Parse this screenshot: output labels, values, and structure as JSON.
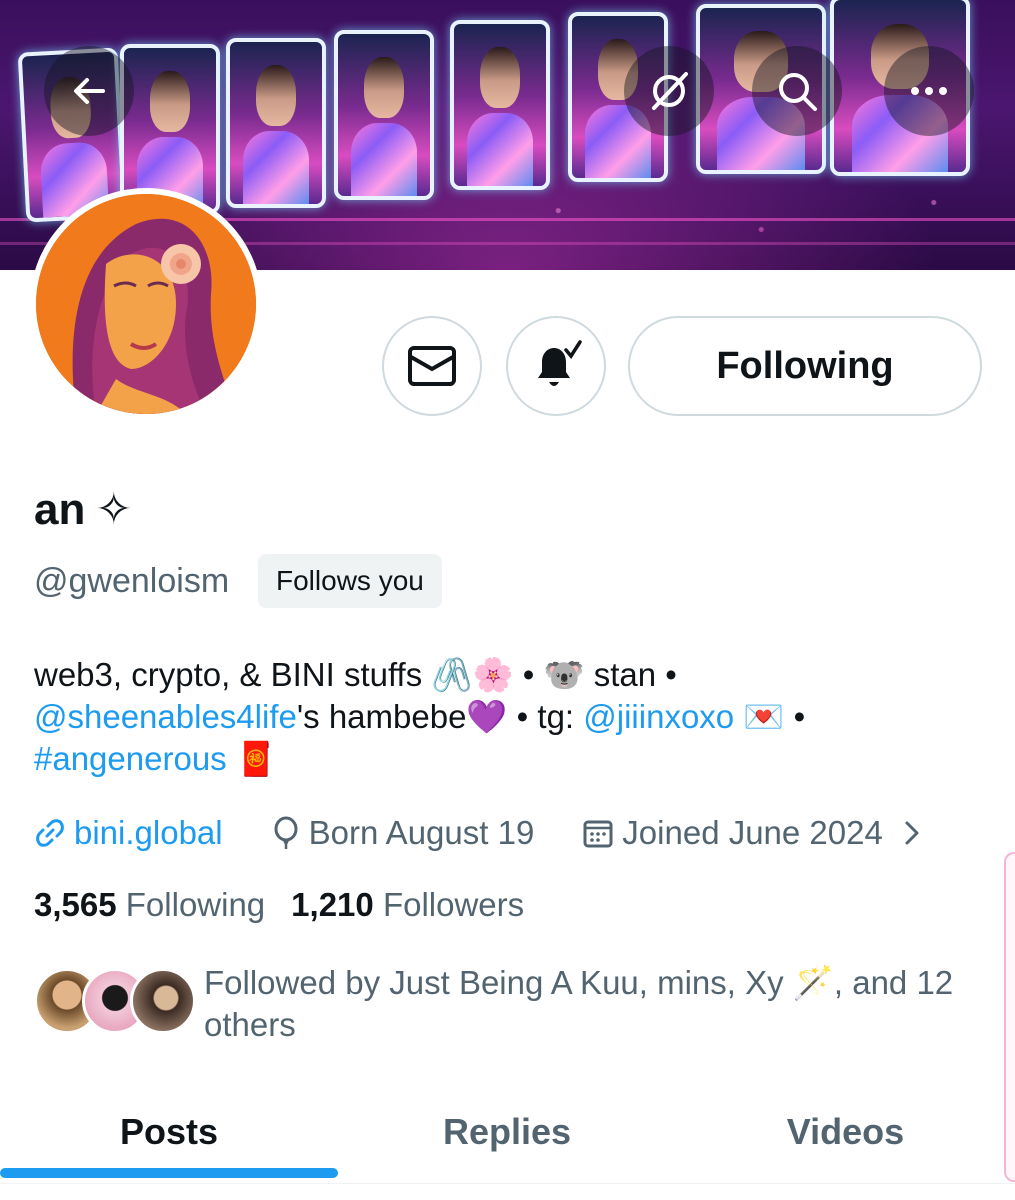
{
  "header": {
    "back_icon": "arrow-left-icon",
    "grok_icon": "grok-icon",
    "search_icon": "search-icon",
    "more_icon": "more-horizontal-icon"
  },
  "profile": {
    "display_name": "an",
    "display_name_emoji": "✧",
    "handle": "@gwenloism",
    "follows_you_label": "Follows you",
    "bio": {
      "line1": "web3, crypto, & BINI stuffs 🖇️🌸 • 🐨 stan •",
      "mention1": "@sheenables4life",
      "line2_mid": "'s hambebe💜 • tg: ",
      "mention2": "@jiiinxoxo",
      "line2_end": " 💌 •",
      "hashtag": "#angenerous",
      "hashtag_emoji": " 🧧"
    },
    "website": "bini.global",
    "birthday": "Born August 19",
    "joined": "Joined June 2024"
  },
  "actions": {
    "message_icon": "mail-icon",
    "notify_icon": "bell-check-icon",
    "following_label": "Following"
  },
  "stats": {
    "following_count": "3,565",
    "following_label": "Following",
    "followers_count": "1,210",
    "followers_label": "Followers"
  },
  "followed_by": {
    "text": "Followed by Just Being A Kuu, mins, Xy 🪄, and 12 others"
  },
  "tabs": [
    {
      "label": "Posts",
      "active": true
    },
    {
      "label": "Replies",
      "active": false
    },
    {
      "label": "Videos",
      "active": false
    }
  ],
  "colors": {
    "accent": "#1d9bf0",
    "text_primary": "#0f1419",
    "text_secondary": "#536471",
    "border": "#cfd9de"
  }
}
